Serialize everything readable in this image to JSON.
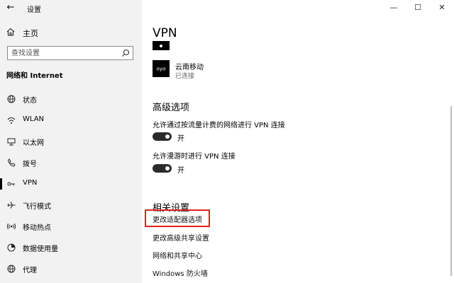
{
  "window": {
    "title": "设置",
    "back_icon": "back-arrow-icon",
    "controls": {
      "minimize": "—",
      "maximize": "☐",
      "close": "✕"
    }
  },
  "sidebar": {
    "home_label": "主页",
    "search_placeholder": "查找设置",
    "section_title": "网络和 Internet",
    "items": [
      {
        "label": "状态",
        "icon": "globe-icon"
      },
      {
        "label": "WLAN",
        "icon": "wifi-icon"
      },
      {
        "label": "以太网",
        "icon": "ethernet-icon"
      },
      {
        "label": "拨号",
        "icon": "phone-icon"
      },
      {
        "label": "VPN",
        "icon": "vpn-icon",
        "active": true
      },
      {
        "label": "飞行模式",
        "icon": "airplane-icon"
      },
      {
        "label": "移动热点",
        "icon": "hotspot-icon"
      },
      {
        "label": "数据使用量",
        "icon": "data-usage-icon"
      },
      {
        "label": "代理",
        "icon": "globe-icon"
      }
    ]
  },
  "main": {
    "title": "VPN",
    "vpn_connection": {
      "name": "云南移动",
      "status": "已连接"
    },
    "advanced": {
      "title": "高级选项",
      "options": [
        {
          "label": "允许通过按流量计费的网络进行 VPN 连接",
          "state": "开"
        },
        {
          "label": "允许漫游时进行 VPN 连接",
          "state": "开"
        }
      ]
    },
    "related": {
      "title": "相关设置",
      "links": [
        "更改适配器选项",
        "更改高级共享设置",
        "网络和共享中心",
        "Windows 防火墙"
      ]
    }
  },
  "colors": {
    "highlight": "#e02020",
    "sidebar_bg": "#f2f2f2",
    "toggle_on": "#2b2b2b"
  }
}
